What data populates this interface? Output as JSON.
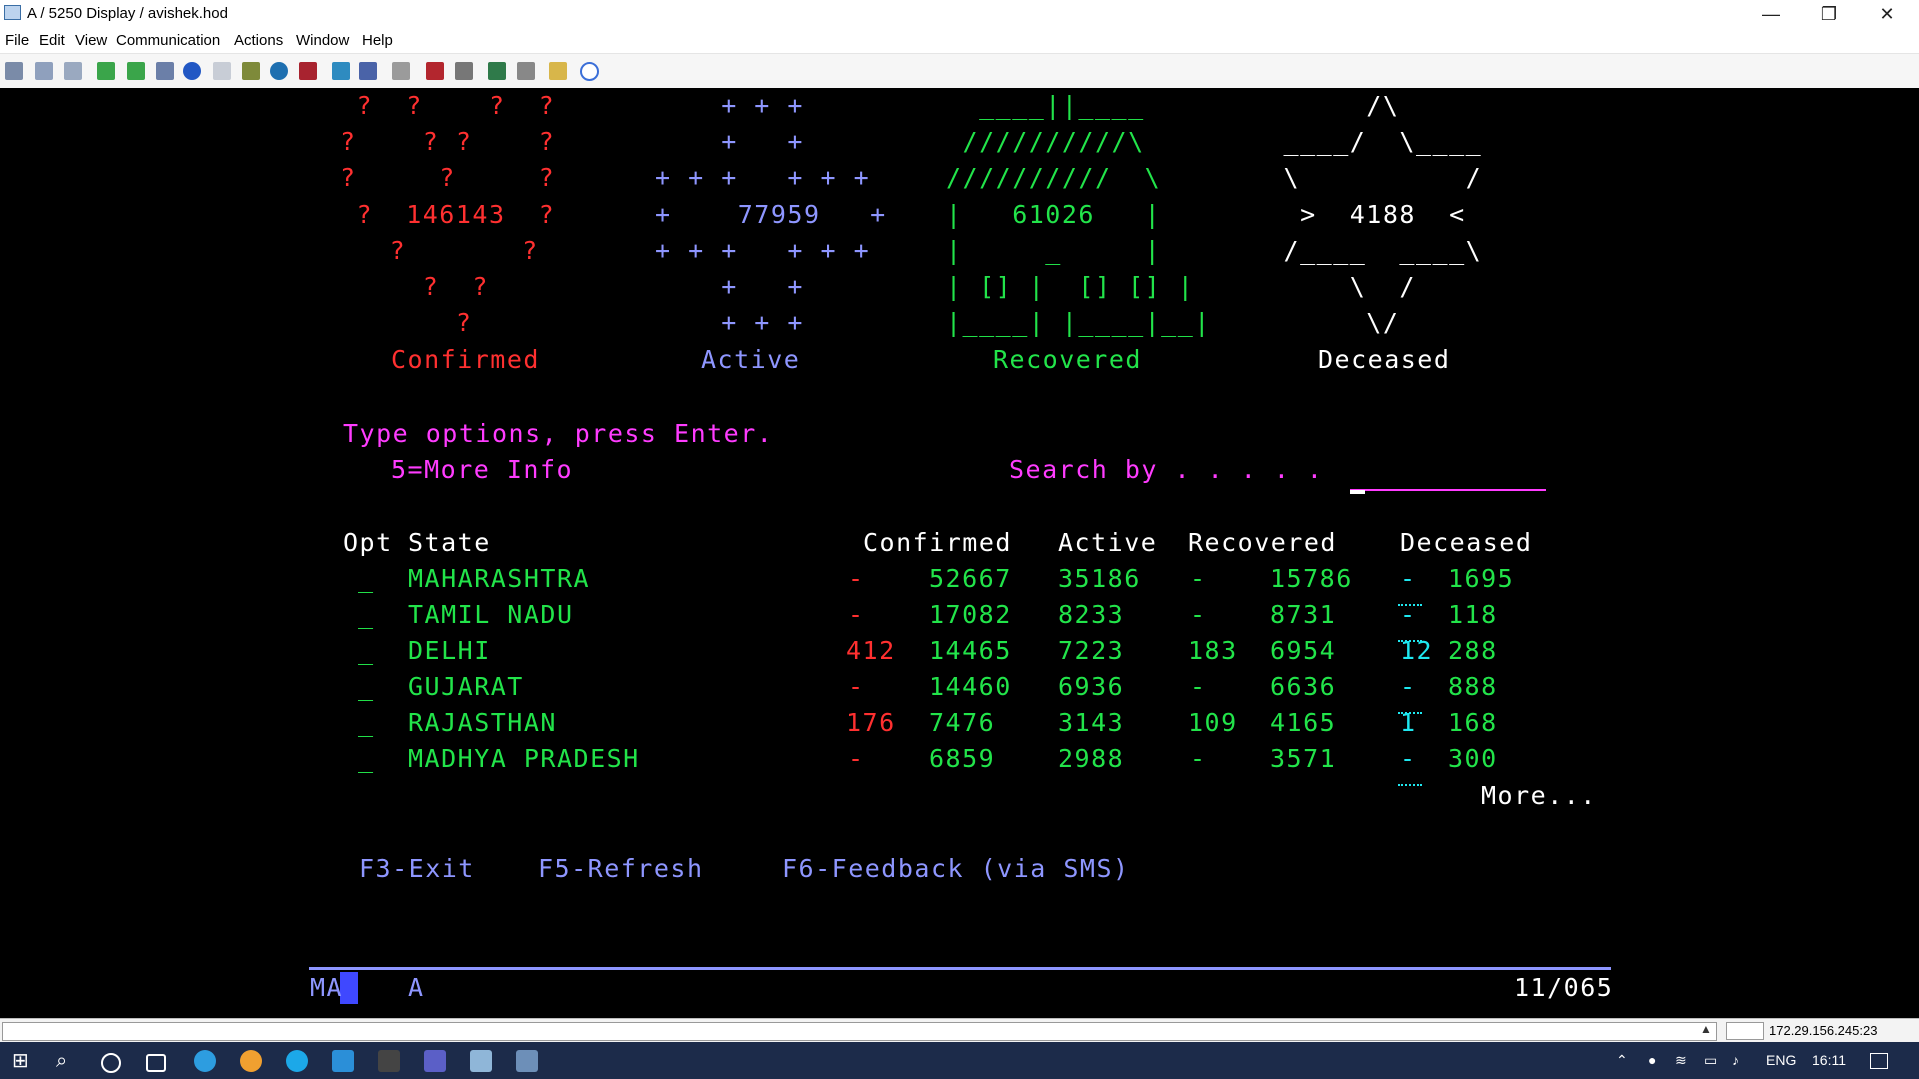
{
  "window": {
    "title": "A / 5250 Display / avishek.hod",
    "minimize": "—",
    "restore": "❐",
    "close": "✕"
  },
  "menu": [
    "File",
    "Edit",
    "View",
    "Communication",
    "Actions",
    "Window",
    "Help"
  ],
  "toolbar_icons": [
    "copy-icon",
    "paste-icon",
    "clipboard-icon",
    "upload-icon",
    "download-icon",
    "save-icon",
    "compass-icon",
    "page-icon",
    "package-icon",
    "macro-icon",
    "record-icon",
    "screen-icon",
    "grid-icon",
    "tools-icon",
    "print-icon",
    "printer-icon",
    "transfer-icon",
    "keys-icon",
    "notes-icon",
    "help-icon"
  ],
  "banner": {
    "confirmed": {
      "art": [
        " ?  ?    ?  ?",
        "?    ? ?    ?",
        "?     ?     ?",
        " ?  146143  ?",
        "   ?       ?",
        "     ?  ?",
        "       ?"
      ],
      "count": "146143",
      "label": "Confirmed"
    },
    "active": {
      "art": [
        "    + + +",
        "    +   +",
        "+ + +   + + +",
        "+    77959   +",
        "+ + +   + + +",
        "    +   +",
        "    + + +"
      ],
      "count": "77959",
      "label": "Active"
    },
    "recovered": {
      "art": [
        "  ____||____",
        " //////////\\",
        "//////////  \\",
        "|   61026   |",
        "|     _     |",
        "| [] |  [] [] |",
        "|____| |____|__|"
      ],
      "count": "61026",
      "label": "Recovered"
    },
    "deceased": {
      "art": [
        "      /\\",
        " ____/  \\____",
        " \\          /",
        "  >  4188  <",
        " /____  ____\\",
        "     \\  /",
        "      \\/"
      ],
      "count": "4188",
      "label": "Deceased"
    }
  },
  "instructions": {
    "line1": "Type options, press Enter.",
    "line2": "5=More Info",
    "search_label": "Search by . . . . ."
  },
  "table": {
    "headers": {
      "opt": "Opt",
      "state": "State",
      "confirmed": "Confirmed",
      "active": "Active",
      "recovered": "Recovered",
      "deceased": "Deceased"
    },
    "rows": [
      {
        "opt": "_",
        "state": "MAHARASHTRA",
        "conf_delta": "-",
        "confirmed": "52667",
        "active": "35186",
        "rec_delta": "-",
        "recovered": "15786",
        "dec_delta": "-",
        "deceased": "1695"
      },
      {
        "opt": "_",
        "state": "TAMIL NADU",
        "conf_delta": "-",
        "confirmed": "17082",
        "active": "8233",
        "rec_delta": "-",
        "recovered": "8731",
        "dec_delta": "-",
        "deceased": "118"
      },
      {
        "opt": "_",
        "state": "DELHI",
        "conf_delta": "412",
        "confirmed": "14465",
        "active": "7223",
        "rec_delta": "183",
        "recovered": "6954",
        "dec_delta": "12",
        "deceased": "288"
      },
      {
        "opt": "_",
        "state": "GUJARAT",
        "conf_delta": "-",
        "confirmed": "14460",
        "active": "6936",
        "rec_delta": "-",
        "recovered": "6636",
        "dec_delta": "-",
        "deceased": "888"
      },
      {
        "opt": "_",
        "state": "RAJASTHAN",
        "conf_delta": "176",
        "confirmed": "7476",
        "active": "3143",
        "rec_delta": "109",
        "recovered": "4165",
        "dec_delta": "1",
        "deceased": "168"
      },
      {
        "opt": "_",
        "state": "MADHYA PRADESH",
        "conf_delta": "-",
        "confirmed": "6859",
        "active": "2988",
        "rec_delta": "-",
        "recovered": "3571",
        "dec_delta": "-",
        "deceased": "300"
      }
    ],
    "more": "More..."
  },
  "function_keys": {
    "f3": "F3-Exit",
    "f5": "F5-Refresh",
    "f6": "F6-Feedback (via SMS)"
  },
  "oia": {
    "left": "MA",
    "mid": "A",
    "position": "11/065"
  },
  "status": {
    "ip": "172.29.156.245:23"
  },
  "taskbar": {
    "icons": [
      "windows-start-icon",
      "search-icon",
      "cortana-icon",
      "task-view-icon",
      "edge-icon",
      "todo-icon",
      "skype-icon",
      "vscode-icon",
      "app-icon",
      "teams-icon",
      "folder-icon",
      "terminal-app-icon"
    ],
    "lang": "ENG",
    "time": "16:11"
  },
  "colors": {
    "red": "#ff3030",
    "blue": "#8e96ff",
    "green": "#22e44a",
    "pink": "#ff3cff",
    "turquoise": "#1ee8f0"
  }
}
